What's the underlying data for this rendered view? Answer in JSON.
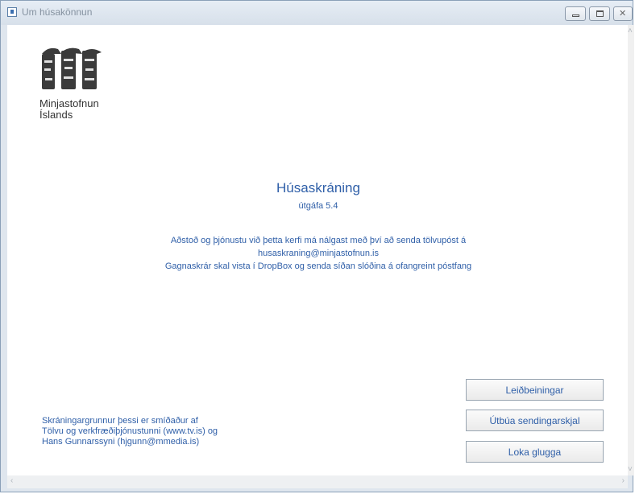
{
  "window": {
    "title": "Um húsakönnun"
  },
  "logo": {
    "text": "Minjastofnun Íslands",
    "line1": "Minjastofnun",
    "line2": "Íslands"
  },
  "app": {
    "title": "Húsaskráning",
    "version": "útgáfa 5.4"
  },
  "info": {
    "line1": "Aðstoð og þjónustu við þetta kerfi má nálgast með því að senda tölvupóst á",
    "line2": "husaskraning@minjastofnun.is",
    "line3": "Gagnaskrár skal vista í DropBox og senda síðan slóðina á ofangreint póstfang"
  },
  "credits": {
    "line1": "Skráningargrunnur þessi er smíðaður af",
    "line2": "Tölvu og verkfræðiþjónustunni (www.tv.is) og",
    "line3": "Hans Gunnarssyni (hjgunn@mmedia.is)"
  },
  "buttons": {
    "guide": "Leiðbeiningar",
    "export": "Útbúa sendingarskjal",
    "close": "Loka glugga"
  },
  "icons": {
    "app": "app-icon",
    "minimize": "minimize-icon",
    "maximize": "maximize-icon",
    "close": "close-icon"
  },
  "colors": {
    "accent": "#2f5fa8"
  }
}
